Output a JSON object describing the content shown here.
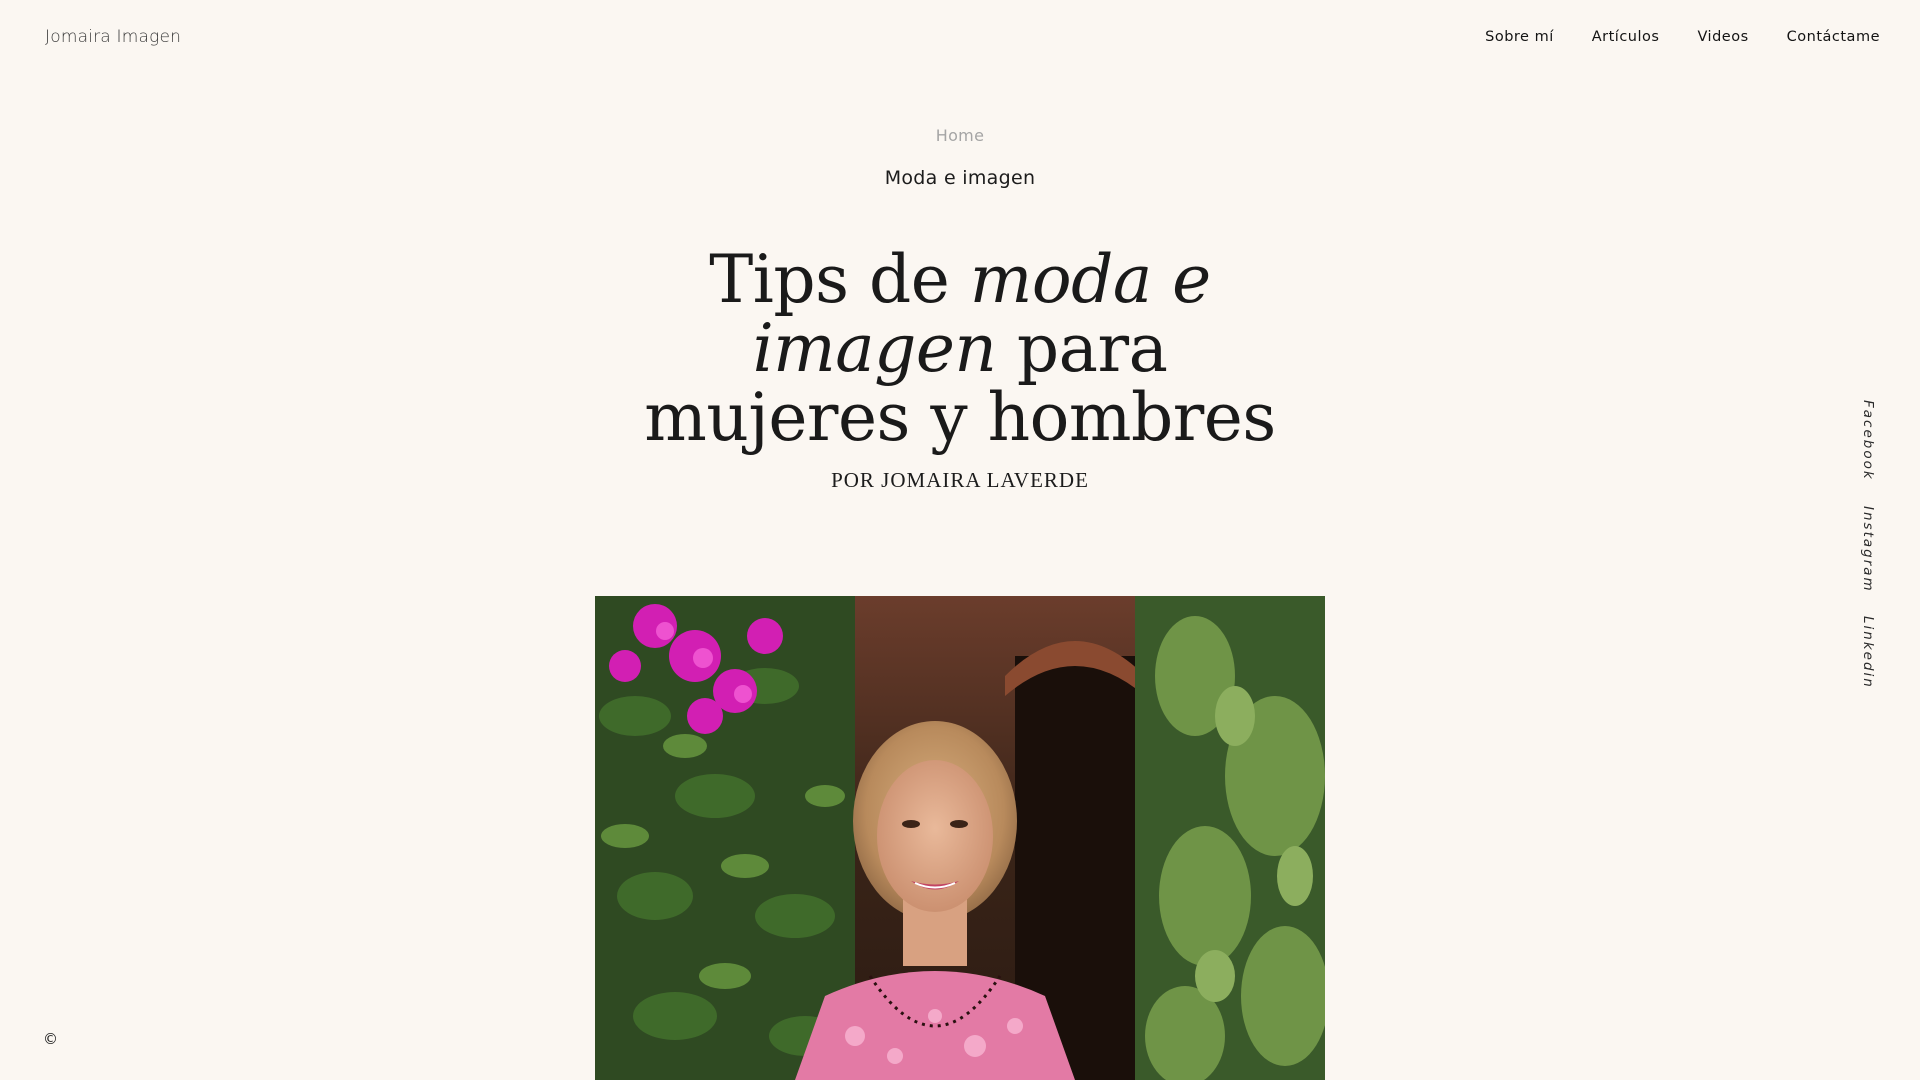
{
  "header": {
    "site_name": "Jomaira Imagen",
    "nav": [
      {
        "label": "Sobre mí"
      },
      {
        "label": "Artículos"
      },
      {
        "label": "Videos"
      },
      {
        "label": "Contáctame"
      }
    ]
  },
  "article": {
    "breadcrumb_home": "Home",
    "category": "Moda e imagen",
    "title_part1": "Tips de ",
    "title_em": "moda e imagen",
    "title_part2": " para mujeres y hombres",
    "byline": "POR JOMAIRA LAVERDE",
    "image_icon": "photo-of-woman-among-flowers"
  },
  "social": {
    "facebook": "Facebook",
    "instagram": "Instagram",
    "linkedin": "Linkedin"
  },
  "footer": {
    "copyright": "©"
  },
  "colors": {
    "background": "#fbf7f2",
    "text": "#1c1c1c",
    "muted": "#a5a5a5"
  }
}
